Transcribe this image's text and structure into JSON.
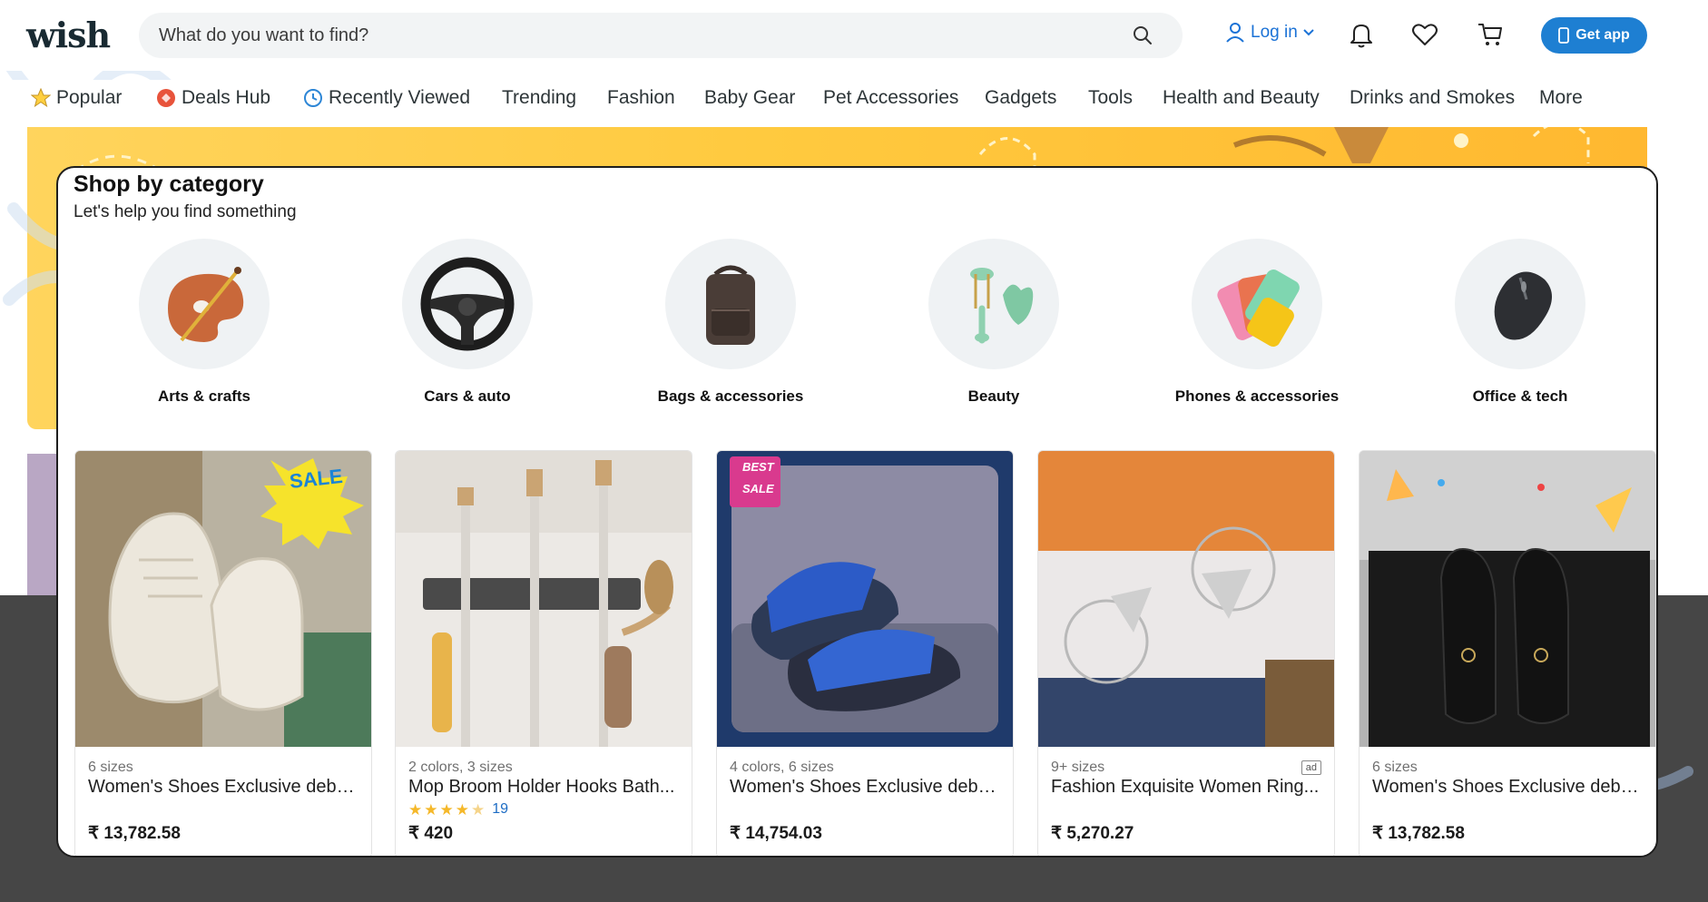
{
  "header": {
    "logo": "wish",
    "search_placeholder": "What do you want to find?",
    "login_label": "Log in",
    "get_app_label": "Get app"
  },
  "nav": {
    "items": [
      {
        "label": "Popular",
        "icon": "star-icon"
      },
      {
        "label": "Deals Hub",
        "icon": "deals-icon"
      },
      {
        "label": "Recently Viewed",
        "icon": "clock-icon"
      },
      {
        "label": "Trending"
      },
      {
        "label": "Fashion"
      },
      {
        "label": "Baby Gear"
      },
      {
        "label": "Pet Accessories"
      },
      {
        "label": "Gadgets"
      },
      {
        "label": "Tools"
      },
      {
        "label": "Health and Beauty"
      },
      {
        "label": "Drinks and Smokes"
      },
      {
        "label": "More"
      }
    ]
  },
  "category_card": {
    "title": "Shop by category",
    "subtitle": "Let's help you find something",
    "categories": [
      {
        "label": "Arts & crafts",
        "icon": "palette-icon"
      },
      {
        "label": "Cars & auto",
        "icon": "steering-wheel-icon"
      },
      {
        "label": "Bags & accessories",
        "icon": "backpack-icon"
      },
      {
        "label": "Beauty",
        "icon": "face-roller-icon"
      },
      {
        "label": "Phones & accessories",
        "icon": "phone-case-icon"
      },
      {
        "label": "Office & tech",
        "icon": "mouse-icon"
      }
    ]
  },
  "products": [
    {
      "meta": "6 sizes",
      "name": "Women's Shoes Exclusive debu...",
      "price": "₹ 13,782.58",
      "badge": "SALE"
    },
    {
      "meta": "2 colors, 3 sizes",
      "name": "Mop Broom Holder Hooks Bath...",
      "price": "₹ 420",
      "rating_count": "19"
    },
    {
      "meta": "4 colors, 6 sizes",
      "name": "Women's Shoes Exclusive debu...",
      "price": "₹ 14,754.03",
      "badge_top": "BEST",
      "badge_bottom": "SALE"
    },
    {
      "meta": "9+ sizes",
      "name": "Fashion Exquisite Women Ring...",
      "price": "₹ 5,270.27",
      "ad": "ad"
    },
    {
      "meta": "6 sizes",
      "name": "Women's Shoes Exclusive debu...",
      "price": "₹ 13,782.58"
    }
  ],
  "colors": {
    "brand_blue": "#1e7fd2",
    "banner_yellow": "#ffca3f",
    "dark_band": "#464646"
  }
}
